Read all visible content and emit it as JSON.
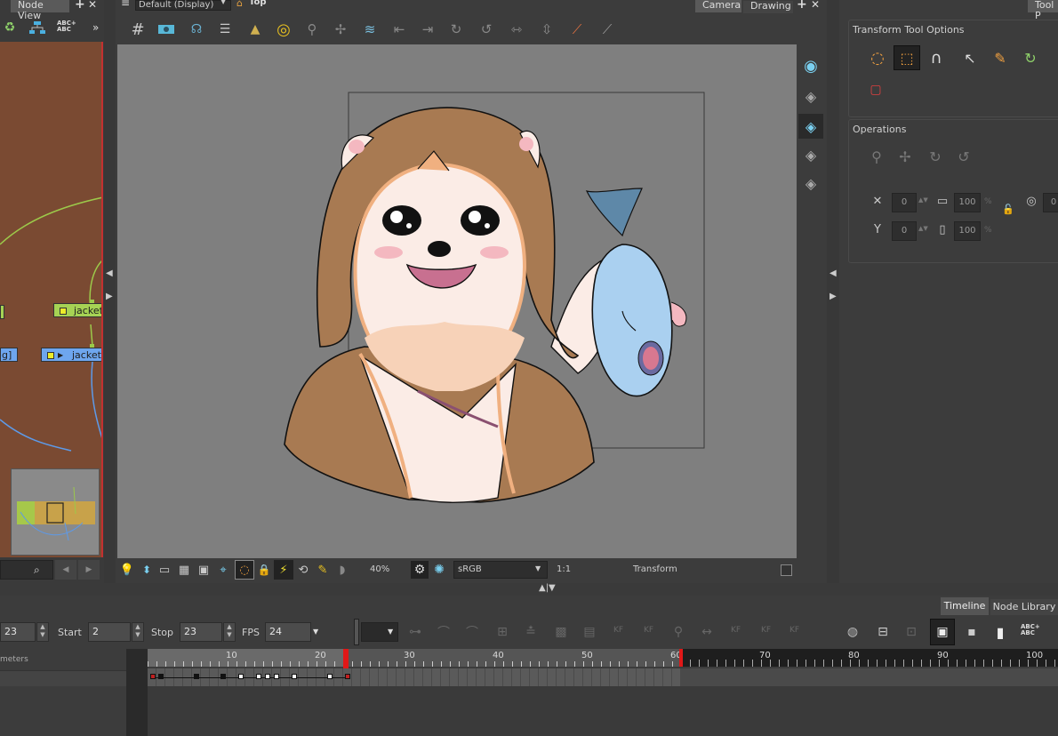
{
  "node_view": {
    "tab_label": "Node View",
    "plus": "+",
    "close": "✕",
    "abc_label": "ABC+ ABC",
    "more": "»",
    "nodes": [
      {
        "label": "jacket_"
      },
      {
        "label": "jacket_"
      },
      {
        "label": "g]"
      }
    ],
    "search_icon": "search-icon",
    "nav_prev": "◀",
    "nav_next": "▶"
  },
  "camera_view": {
    "display_select": "Default (Display)",
    "view_label": "Top",
    "tabs": [
      {
        "label": "Camera"
      },
      {
        "label": "Drawing"
      }
    ],
    "plus": "+",
    "close": "✕",
    "zoom": "40%",
    "color_space": "sRGB",
    "ratio": "1:1",
    "status": "Transform"
  },
  "tool_properties": {
    "tab_label": "Tool P",
    "options_title": "Transform Tool Options",
    "operations_title": "Operations",
    "fields": {
      "x": "0",
      "y": "0",
      "width": "100",
      "height": "100",
      "angle": "0",
      "percent": "%"
    }
  },
  "timeline": {
    "tabs": [
      {
        "label": "Timeline"
      },
      {
        "label": "Node Library"
      }
    ],
    "current_frame": "23",
    "start_label": "Start",
    "start_value": "2",
    "stop_label": "Stop",
    "stop_value": "23",
    "fps_label": "FPS",
    "fps_value": "24",
    "layer_header": "meters",
    "ruler": [
      "10",
      "20",
      "30",
      "40",
      "50",
      "60",
      "70",
      "80",
      "90",
      "100"
    ],
    "kf_labels": [
      "KF",
      "KF",
      "KF",
      "KF",
      "KF"
    ],
    "abc_label": "ABC+ ABC"
  },
  "colors": {
    "node_bg": "#7a4a32",
    "node_green": "#9cc94a",
    "node_blue": "#5d9ae8",
    "playhead": "#e01818",
    "panel": "#3c3c3c"
  }
}
